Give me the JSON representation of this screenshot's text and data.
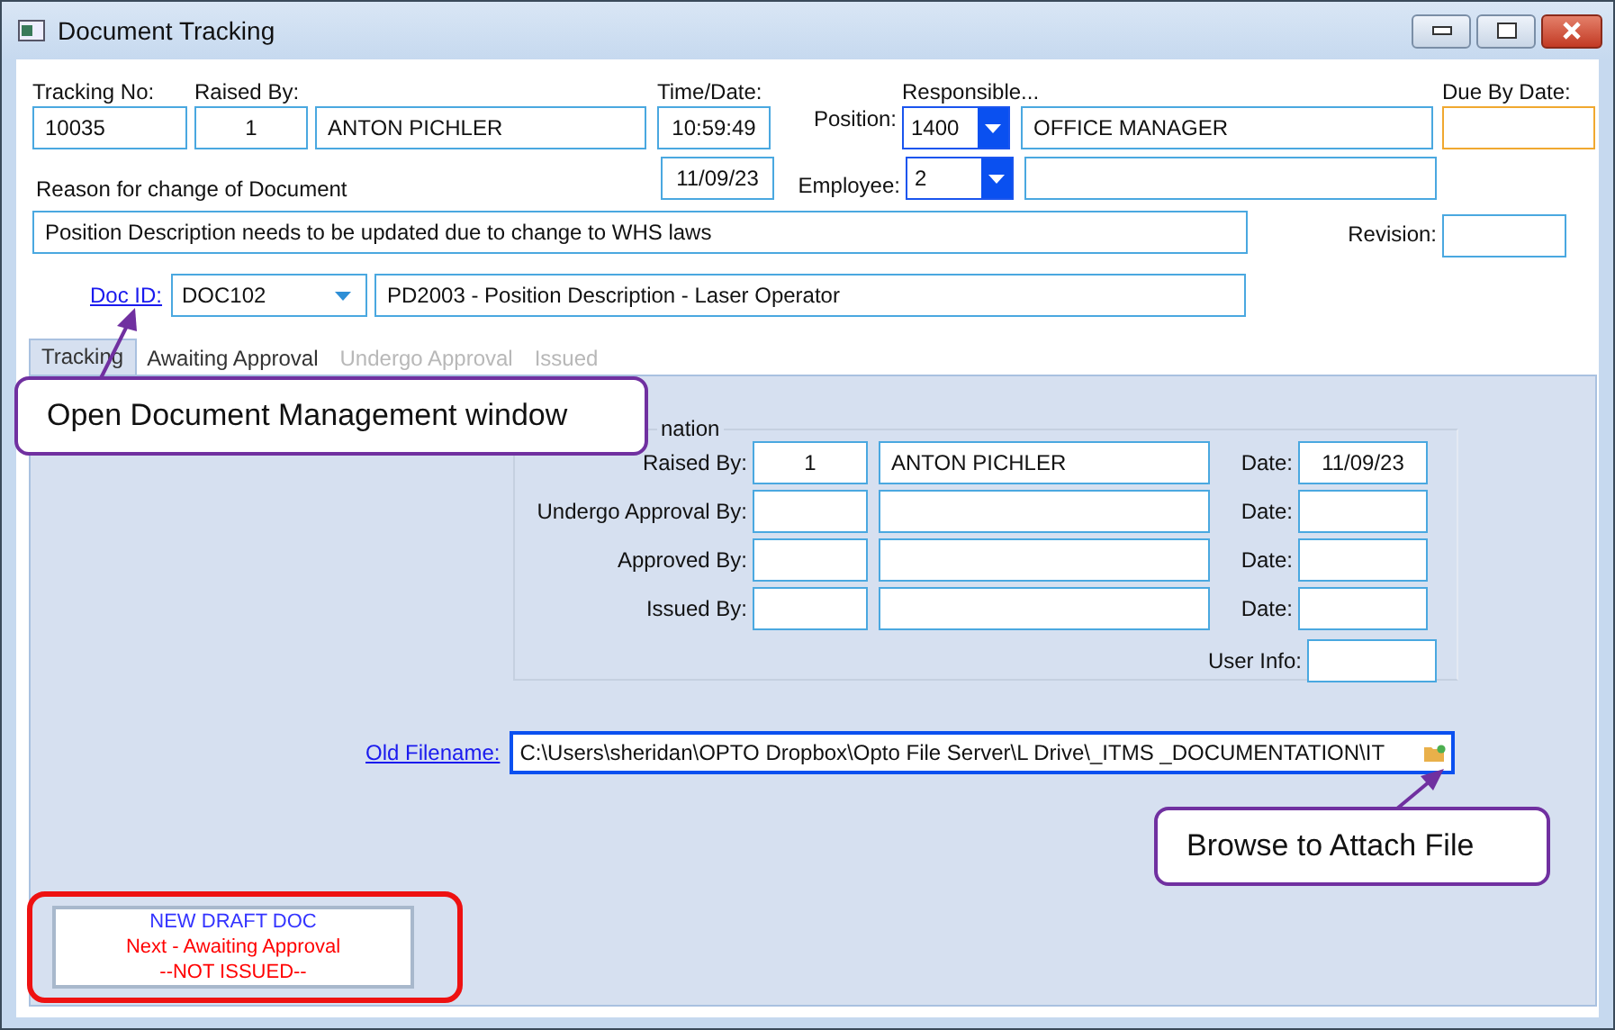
{
  "window": {
    "title": "Document Tracking"
  },
  "header": {
    "tracking_no": {
      "label": "Tracking No:",
      "value": "10035"
    },
    "raised_by": {
      "label": "Raised By:",
      "id": "1",
      "name": "ANTON PICHLER"
    },
    "time_date": {
      "label": "Time/Date:",
      "time": "10:59:49",
      "date": "11/09/23"
    },
    "responsible": {
      "label": "Responsible...",
      "position_label": "Position:",
      "position_id": "1400",
      "position_name": "OFFICE MANAGER",
      "employee_label": "Employee:",
      "employee_id": "2"
    },
    "due_by": {
      "label": "Due By Date:"
    },
    "reason": {
      "label": "Reason for change of Document",
      "value": "Position Description needs to be updated due to change to WHS laws"
    },
    "revision": {
      "label": "Revision:"
    },
    "doc": {
      "link": "Doc ID:",
      "id": "DOC102",
      "title": "PD2003 - Position Description - Laser Operator"
    }
  },
  "tabs": [
    {
      "label": "Tracking",
      "selected": true,
      "disabled": false
    },
    {
      "label": "Awaiting Approval",
      "selected": false,
      "disabled": false
    },
    {
      "label": "Undergo Approval",
      "selected": false,
      "disabled": true
    },
    {
      "label": "Issued",
      "selected": false,
      "disabled": true
    }
  ],
  "group": {
    "title": "nation",
    "rows": [
      {
        "label": "Raised By:",
        "id": "1",
        "name": "ANTON PICHLER",
        "date_label": "Date:",
        "date": "11/09/23"
      },
      {
        "label": "Undergo Approval By:",
        "date_label": "Date:"
      },
      {
        "label": "Approved By:",
        "date_label": "Date:"
      },
      {
        "label": "Issued By:",
        "date_label": "Date:"
      }
    ],
    "user_info_label": "User Info:"
  },
  "file": {
    "link": "Old Filename:",
    "value": "C:\\Users\\sheridan\\OPTO Dropbox\\Opto File Server\\L Drive\\_ITMS _DOCUMENTATION\\IT"
  },
  "status": [
    {
      "text": "NEW DRAFT DOC",
      "color": "#3333ff"
    },
    {
      "text": "Next - Awaiting Approval",
      "color": "#ff0000"
    },
    {
      "text": "--NOT ISSUED--",
      "color": "#ff0000"
    }
  ],
  "callouts": [
    {
      "text": "Open Document Management window"
    },
    {
      "text": "Browse to Attach File"
    }
  ]
}
